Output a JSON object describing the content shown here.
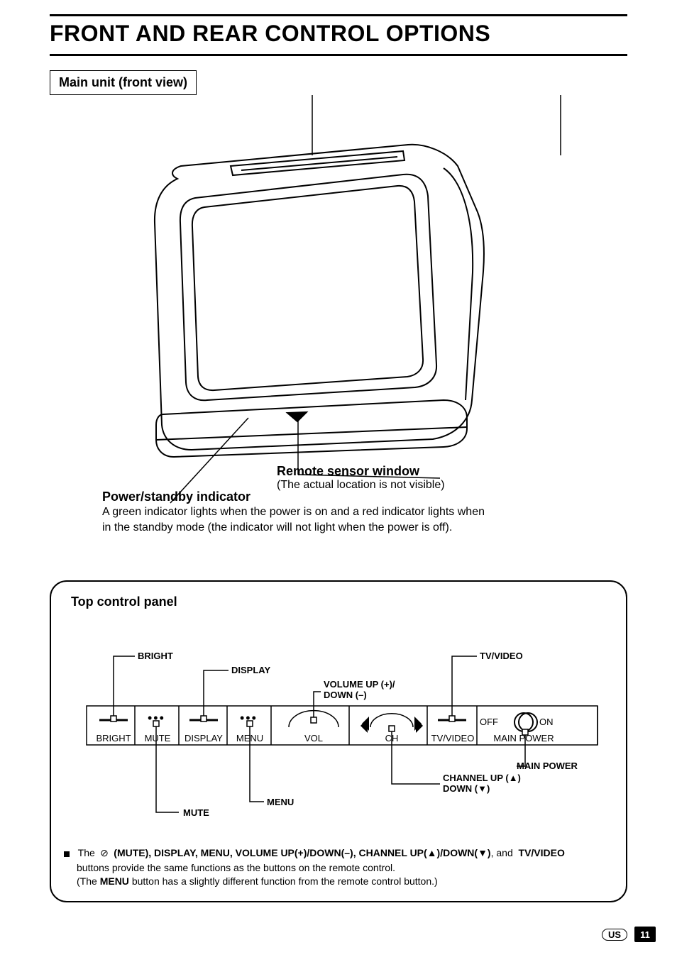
{
  "title": "FRONT AND REAR CONTROL OPTIONS",
  "subtitle": "Main unit (front view)",
  "remote": {
    "title": "Remote sensor window",
    "sub": "(The actual location is not visible)"
  },
  "power": {
    "title": "Power/standby indicator",
    "body": "A green indicator lights when the power is on and a red indicator lights when in the standby mode (the indicator will not light when the power is off)."
  },
  "panel": {
    "title": "Top control panel",
    "callouts": {
      "bright": "BRIGHT",
      "display": "DISPLAY",
      "volume": "VOLUME UP (+)/\nDOWN (–)",
      "tv": "TV/VIDEO",
      "mute": "MUTE",
      "menu": "MENU",
      "channel": "CHANNEL UP (▲)\nDOWN (▼)",
      "mainpower": "MAIN POWER"
    },
    "strip": {
      "off": "OFF",
      "on": "ON",
      "bright": "BRIGHT",
      "mute": "MUTE",
      "display": "DISPLAY",
      "menu": "MENU",
      "vol": "VOL",
      "ch": "CH",
      "tv": "TV/VIDEO",
      "mainpower": "MAIN POWER"
    },
    "note": {
      "pre": "The",
      "bold1": "(MUTE), DISPLAY, MENU, VOLUME UP(+)/DOWN(–), CHANNEL UP(▲)/DOWN(▼)",
      "mid": ", and",
      "bold2": "TV/VIDEO",
      "line2": "buttons provide the same functions as the buttons on the remote control.",
      "line3pre": "(The",
      "line3bold": "MENU",
      "line3post": "button has a slightly different function from the remote control button.)"
    }
  },
  "footer": {
    "region": "US",
    "page": "11"
  }
}
